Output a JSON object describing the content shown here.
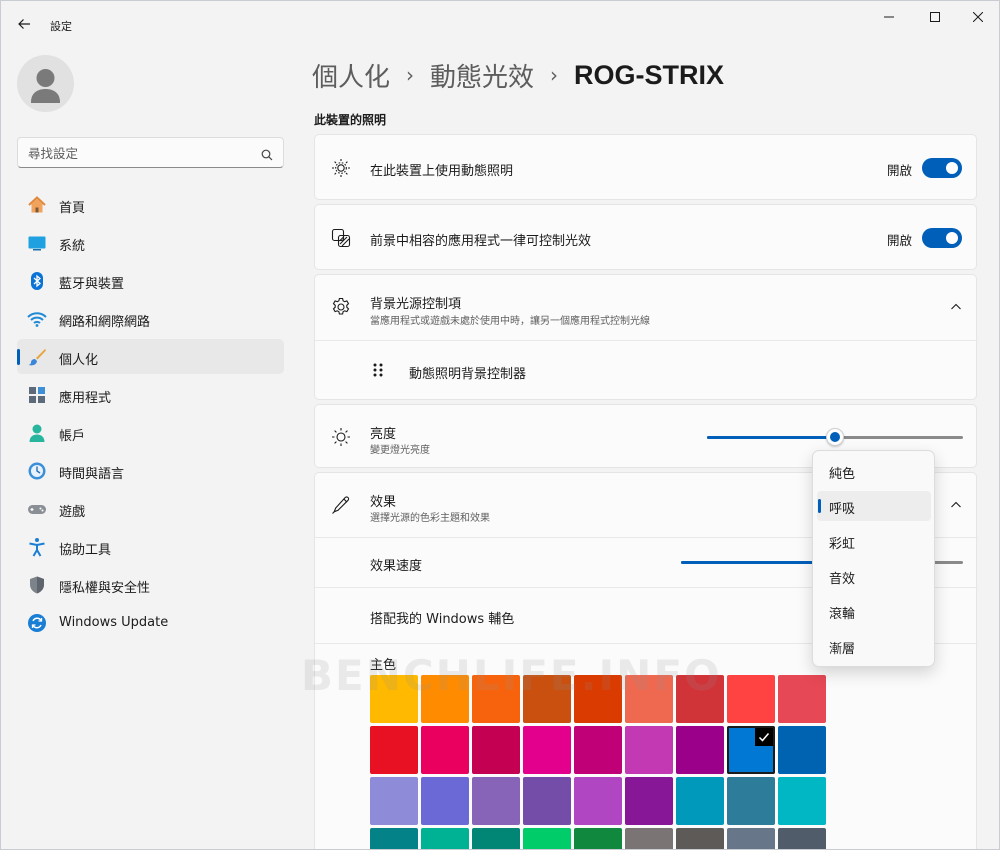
{
  "titlebar": {
    "app_title": "設定"
  },
  "search": {
    "placeholder": "尋找設定"
  },
  "sidebar": {
    "items": [
      {
        "label": "首頁",
        "icon": "home-icon"
      },
      {
        "label": "系統",
        "icon": "system-icon"
      },
      {
        "label": "藍牙與裝置",
        "icon": "bluetooth-icon"
      },
      {
        "label": "網路和網際網路",
        "icon": "wifi-icon"
      },
      {
        "label": "個人化",
        "icon": "brush-icon",
        "selected": true
      },
      {
        "label": "應用程式",
        "icon": "apps-icon"
      },
      {
        "label": "帳戶",
        "icon": "account-icon"
      },
      {
        "label": "時間與語言",
        "icon": "time-language-icon"
      },
      {
        "label": "遊戲",
        "icon": "gaming-icon"
      },
      {
        "label": "協助工具",
        "icon": "accessibility-icon"
      },
      {
        "label": "隱私權與安全性",
        "icon": "shield-icon"
      },
      {
        "label": "Windows Update",
        "icon": "windows-update-icon"
      }
    ]
  },
  "breadcrumb": {
    "level1": "個人化",
    "level2": "動態光效",
    "current": "ROG-STRIX",
    "separator": "›"
  },
  "section": {
    "title": "此裝置的照明"
  },
  "rows": {
    "use_dynamic": {
      "title": "在此裝置上使用動態照明",
      "state": "開啟",
      "on": true
    },
    "foreground": {
      "title": "前景中相容的應用程式一律可控制光效",
      "state": "開啟",
      "on": true
    },
    "background": {
      "title": "背景光源控制項",
      "subtitle": "當應用程式或遊戲未處於使用中時，讓另一個應用程式控制光線",
      "child": "動態照明背景控制器"
    },
    "brightness": {
      "title": "亮度",
      "subtitle": "變更燈光亮度",
      "value": 0.5
    },
    "effects": {
      "title": "效果",
      "subtitle": "選擇光源的色彩主題和效果",
      "speed_label": "效果速度",
      "speed_value": 0.5,
      "match_accent_label": "搭配我的 Windows 輔色",
      "main_color_label": "主色"
    }
  },
  "dropdown": {
    "options": [
      "純色",
      "呼吸",
      "彩虹",
      "音效",
      "滾輪",
      "漸層"
    ],
    "selected": "呼吸"
  },
  "colors": {
    "accent": "#005fb8",
    "swatches": [
      "#ffb900",
      "#ff8c00",
      "#f7630c",
      "#ca5010",
      "#da3b01",
      "#ef6950",
      "#d13438",
      "#ff4343",
      "#e74856",
      "#e81123",
      "#ea005e",
      "#c30052",
      "#e3008c",
      "#bf0077",
      "#c239b3",
      "#9a0089",
      "#0078d4",
      "#0063b1",
      "#8e8cd8",
      "#6b69d6",
      "#8764b8",
      "#744da9",
      "#b146c2",
      "#881798",
      "#0099bc",
      "#2d7d9a",
      "#00b7c3",
      "#038387",
      "#00b294",
      "#018574",
      "#00cc6a",
      "#10893e",
      "#7a7574",
      "#5d5a58",
      "#68768a",
      "#515c6b"
    ],
    "selected_swatch_index": 16
  },
  "watermark": {
    "text": "BENCHLIFE.INFO"
  }
}
